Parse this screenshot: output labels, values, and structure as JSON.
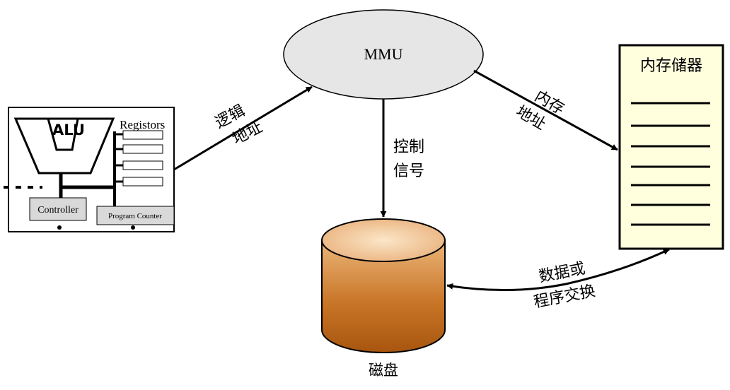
{
  "cpu": {
    "alu_label": "ALU",
    "registers_label": "Registors",
    "controller_label": "Controller",
    "program_counter_label": "Program Counter"
  },
  "mmu": {
    "label": "MMU"
  },
  "memory": {
    "title": "内存储器"
  },
  "disk": {
    "label": "磁盘"
  },
  "arrows": {
    "logical_address": [
      "逻辑",
      "地址"
    ],
    "memory_address": [
      "内存",
      "地址"
    ],
    "control_signal": [
      "控制",
      "信号"
    ],
    "swap": [
      "数据或",
      "程序交换"
    ]
  },
  "colors": {
    "mmu_fill": "#e6e6e6",
    "memory_fill": "#ffffde",
    "disk_top": "#f5d7b0",
    "disk_body_dark": "#a8550f",
    "box_fill": "#d9d9d9"
  }
}
